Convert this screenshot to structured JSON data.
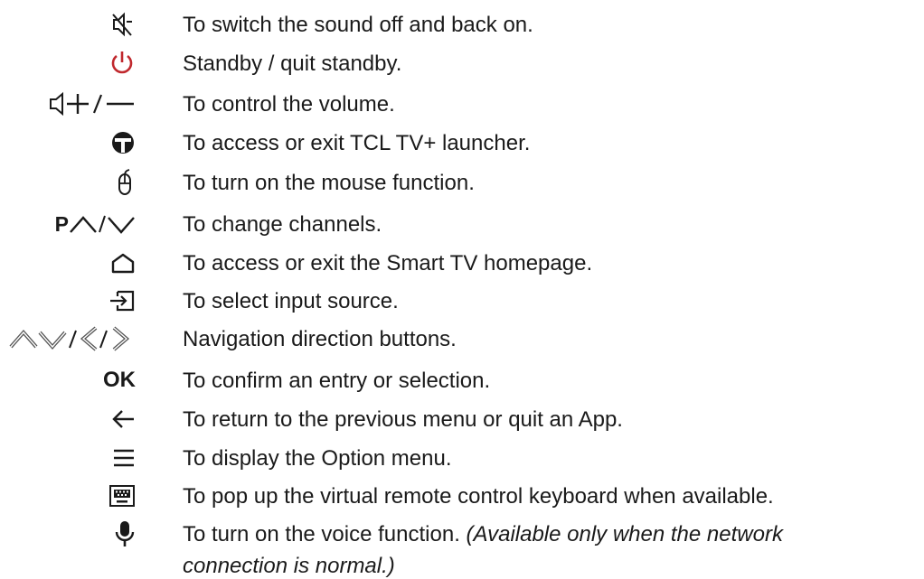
{
  "rows": [
    {
      "icon": "mute-icon",
      "text": "To switch the sound off and back on."
    },
    {
      "icon": "power-icon",
      "text": "Standby / quit standby."
    },
    {
      "icon": "volume-plus-minus-icon",
      "text": "To control the volume."
    },
    {
      "icon": "tcl-launcher-icon",
      "text": "To access or exit TCL TV+ launcher."
    },
    {
      "icon": "mouse-icon",
      "text": "To turn on the mouse function."
    },
    {
      "icon": "channel-up-down-icon",
      "icon_text": "P",
      "text": "To change channels."
    },
    {
      "icon": "home-icon",
      "text": "To access or exit the Smart TV homepage."
    },
    {
      "icon": "input-source-icon",
      "text": "To select input source."
    },
    {
      "icon": "navigation-arrows-icon",
      "text": "Navigation direction buttons."
    },
    {
      "icon": "ok-icon",
      "icon_text": "OK",
      "text": "To confirm an entry or selection."
    },
    {
      "icon": "back-arrow-icon",
      "text": "To return to the previous menu or quit an App."
    },
    {
      "icon": "menu-icon",
      "text": "To display the Option menu."
    },
    {
      "icon": "keyboard-icon",
      "text": "To pop up the virtual remote control keyboard when available."
    },
    {
      "icon": "microphone-icon",
      "text": "To turn on the voice function.",
      "note_line1": "(Available only when the network",
      "note_line2": "connection is normal.)"
    }
  ],
  "colors": {
    "text": "#1a1a1a",
    "power": "#c0282d"
  }
}
